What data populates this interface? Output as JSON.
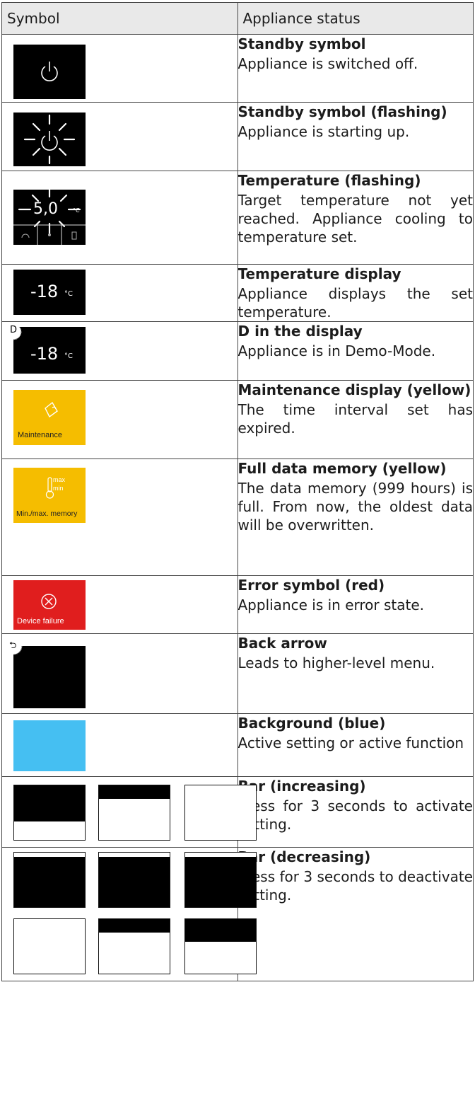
{
  "header": {
    "col1": "Symbol",
    "col2": "Appliance status"
  },
  "rows": [
    {
      "title": "Standby symbol",
      "desc": "Appliance is switched off."
    },
    {
      "title": "Standby symbol (flashing)",
      "desc": "Appliance is starting up."
    },
    {
      "title": "Temperature (flashing)",
      "desc": "Target temperature not yet reached. Appliance cooling to temperature set."
    },
    {
      "title": "Temperature display",
      "desc": "Appliance displays the set temperature."
    },
    {
      "title": "D in the display",
      "desc": "Appliance is in Demo-Mode."
    },
    {
      "title": "Maintenance display (yellow)",
      "desc": "The time interval set has expired."
    },
    {
      "title": "Full data memory (yellow)",
      "desc": "The data memory (999 hours) is full. From now, the oldest data will be overwritten."
    },
    {
      "title": "Error symbol (red)",
      "desc": "Appliance is in error state."
    },
    {
      "title": "Back arrow",
      "desc": "Leads to higher-level menu."
    },
    {
      "title": "Background (blue)",
      "desc": "Active setting or active function"
    },
    {
      "title": "Bar (increasing)",
      "desc": "Press for 3 seconds to activate setting."
    },
    {
      "title": "Bar (decreasing)",
      "desc": "Press for 3 seconds to deactivate setting."
    }
  ],
  "symbols": {
    "temp_flashing": "5,0",
    "temp_unit": "°C",
    "temp_display": "-18",
    "temp_display_unit": "°C",
    "demo_letter": "D",
    "maintenance_label": "Maintenance",
    "memory_max": "max",
    "memory_min": "min",
    "memory_label": "Min./max. memory",
    "error_label": "Device failure"
  },
  "colors": {
    "yellow": "#f5bd00",
    "red": "#e01e1e",
    "blue": "#45bff2",
    "black": "#000000"
  },
  "bars": {
    "increasing_fill_levels": [
      0.66,
      0.25,
      0.0
    ],
    "decreasing_fill_levels_row1": [
      0.92,
      0.92,
      0.92
    ],
    "decreasing_fill_levels_row2": [
      0.0,
      0.25,
      0.42
    ]
  }
}
